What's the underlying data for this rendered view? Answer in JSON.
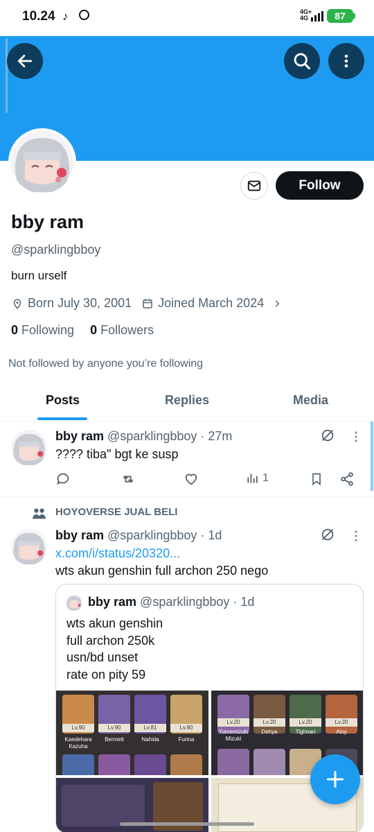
{
  "status_bar": {
    "time": "10.24",
    "network": "4G+",
    "network_sub": "4G",
    "battery": "87"
  },
  "profile": {
    "name": "bby ram",
    "handle": "@sparklingbboy",
    "bio": "burn urself",
    "born": "Born July 30, 2001",
    "joined": "Joined March 2024",
    "following_count": "0",
    "following_label": "Following",
    "followers_count": "0",
    "followers_label": "Followers",
    "not_followed": "Not followed by anyone you’re following",
    "follow_button": "Follow"
  },
  "tabs": [
    {
      "label": "Posts",
      "active": true
    },
    {
      "label": "Replies",
      "active": false
    },
    {
      "label": "Media",
      "active": false
    }
  ],
  "posts": [
    {
      "name": "bby ram",
      "meta": "@sparklingbboy · 27m",
      "text": "???? tiba\" bgt ke susp",
      "views": "1"
    },
    {
      "community": "HOYOVERSE JUAL BELI",
      "name": "bby ram",
      "meta": "@sparklingbboy · 1d",
      "link": "x.com/i/status/20320...",
      "text": "wts akun genshin full archon 250 nego",
      "quote": {
        "name": "bby ram",
        "meta": "@sparklingbboy · 1d",
        "lines": [
          "wts akun genshin",
          "full archon 250k",
          "usn/bd unset",
          "rate on pity 59"
        ]
      }
    }
  ],
  "media": {
    "left_chars": [
      {
        "lv": "Lv.90",
        "name": "Kaedehara Kazuha"
      },
      {
        "lv": "Lv.90",
        "name": "Bennett"
      },
      {
        "lv": "Lv.81",
        "name": "Nahida"
      },
      {
        "lv": "Lv.80",
        "name": "Furina"
      }
    ],
    "right_chars": [
      {
        "lv": "Lv.20",
        "name": "Yumemizuki Mizuki"
      },
      {
        "lv": "Lv.20",
        "name": "Dehya"
      },
      {
        "lv": "Lv.20",
        "name": "Tighnari"
      },
      {
        "lv": "Lv.20",
        "name": "Aloy"
      }
    ],
    "colors": {
      "accent": "#1d9bf0",
      "dark": "#0f1419",
      "muted": "#536471"
    }
  }
}
